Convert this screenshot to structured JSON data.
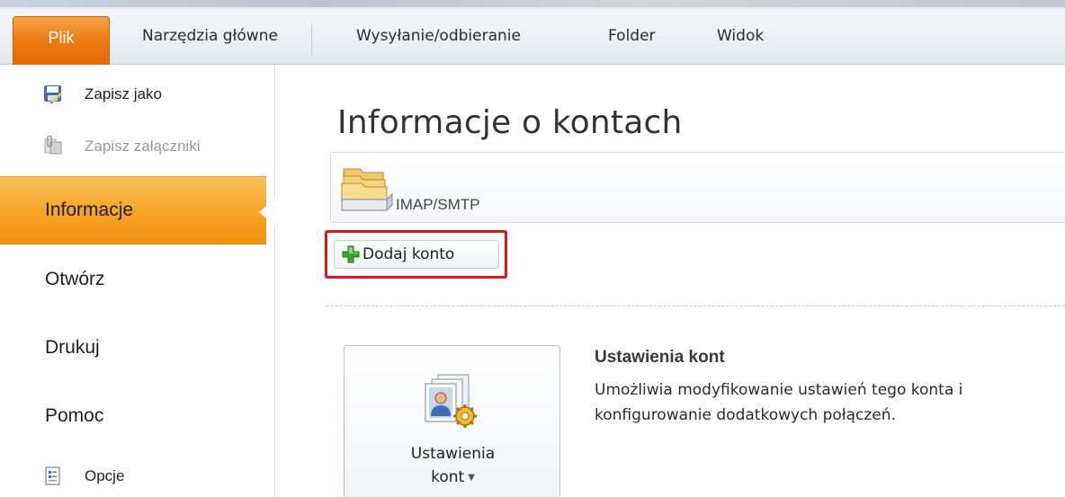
{
  "ribbon": {
    "file_tab": "Plik",
    "tabs": [
      {
        "label": "Narzędzia główne"
      },
      {
        "label": "Wysyłanie/odbieranie"
      },
      {
        "label": "Folder"
      },
      {
        "label": "Widok"
      }
    ]
  },
  "backstage_nav": {
    "commands": [
      {
        "label": "Zapisz jako",
        "icon": "save-as-icon"
      },
      {
        "label": "Zapisz załączniki",
        "icon": "save-attachments-icon"
      }
    ],
    "items": [
      {
        "label": "Informacje",
        "selected": true
      },
      {
        "label": "Otwórz"
      },
      {
        "label": "Drukuj"
      },
      {
        "label": "Pomoc"
      }
    ],
    "options": {
      "label": "Opcje",
      "icon": "options-icon"
    }
  },
  "main": {
    "title": "Informacje o kontach",
    "account": {
      "name": "IMAP/SMTP",
      "icon": "mail-account-icon"
    },
    "add_account_button": "Dodaj konto",
    "account_settings": {
      "button_line1": "Ustawienia",
      "button_line2": "kont",
      "title": "Ustawienia kont",
      "description_line1": "Umożliwia modyfikowanie ustawień tego konta i",
      "description_line2": "konfigurowanie dodatkowych połączeń."
    }
  },
  "colors": {
    "file_tab": "#e97a10",
    "selected_nav": "#f6a42a",
    "highlight_border": "#e0141e",
    "add_icon": "#3aa52a"
  }
}
